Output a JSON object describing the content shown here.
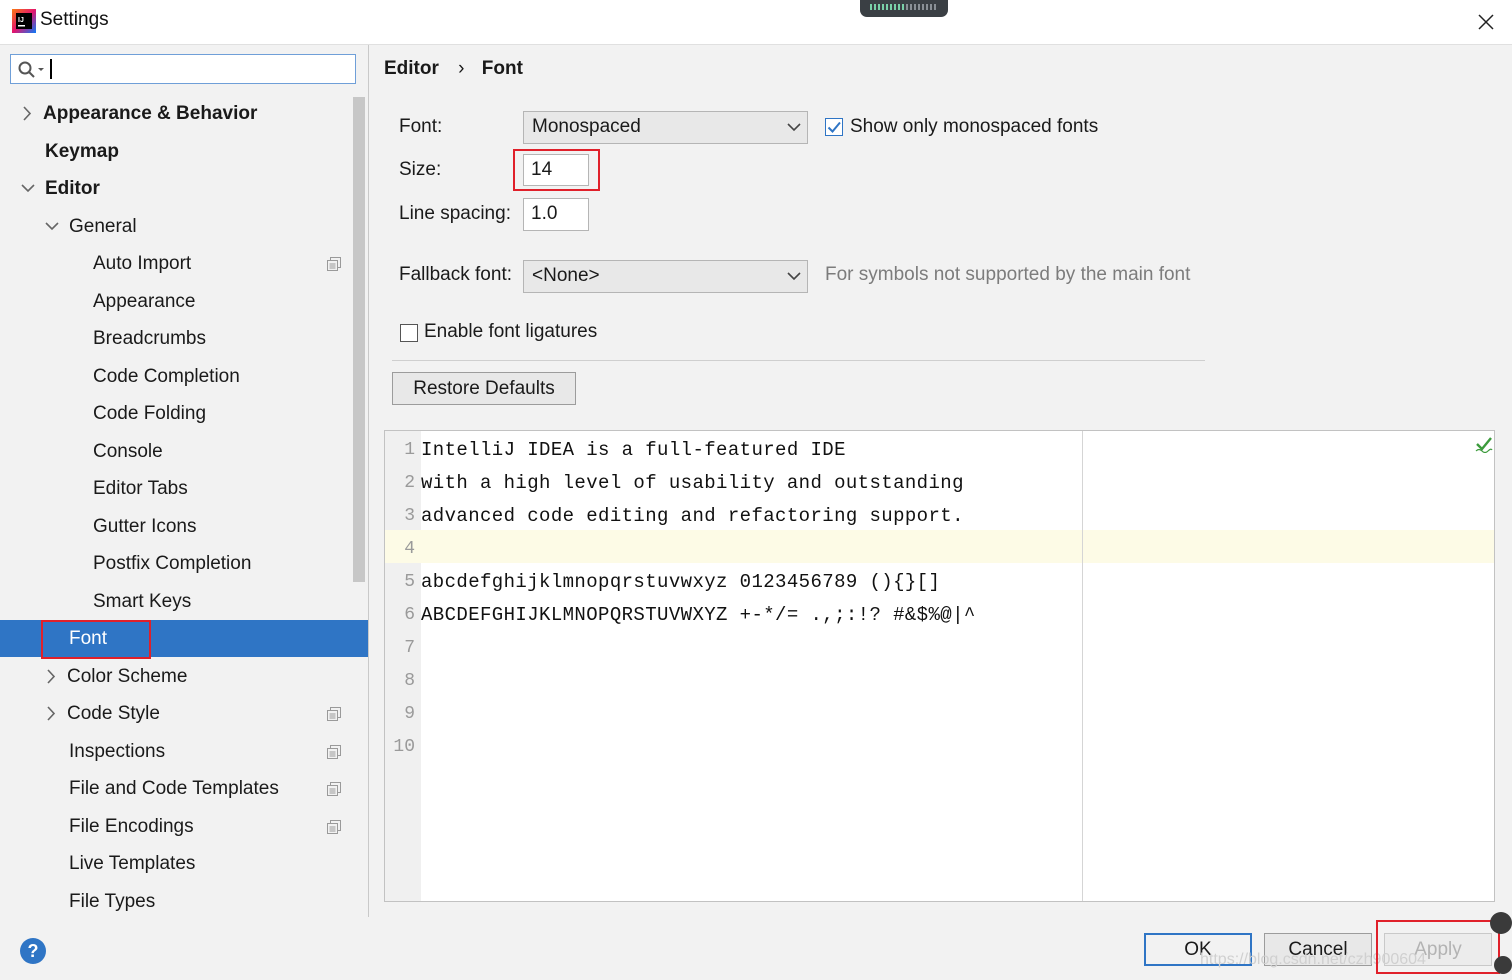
{
  "window": {
    "title": "Settings"
  },
  "search": {
    "value": ""
  },
  "sidebar": {
    "items": [
      {
        "label": "Appearance & Behavior"
      },
      {
        "label": "Keymap"
      },
      {
        "label": "Editor"
      },
      {
        "label": "General"
      },
      {
        "label": "Auto Import"
      },
      {
        "label": "Appearance"
      },
      {
        "label": "Breadcrumbs"
      },
      {
        "label": "Code Completion"
      },
      {
        "label": "Code Folding"
      },
      {
        "label": "Console"
      },
      {
        "label": "Editor Tabs"
      },
      {
        "label": "Gutter Icons"
      },
      {
        "label": "Postfix Completion"
      },
      {
        "label": "Smart Keys"
      },
      {
        "label": "Font"
      },
      {
        "label": "Color Scheme"
      },
      {
        "label": "Code Style"
      },
      {
        "label": "Inspections"
      },
      {
        "label": "File and Code Templates"
      },
      {
        "label": "File Encodings"
      },
      {
        "label": "Live Templates"
      },
      {
        "label": "File Types"
      }
    ],
    "selected": "Font"
  },
  "breadcrumb": {
    "parent": "Editor",
    "separator": "›",
    "current": "Font"
  },
  "font_settings": {
    "font_label": "Font:",
    "font_value": "Monospaced",
    "monospaced_only_label": "Show only monospaced fonts",
    "monospaced_only_checked": true,
    "size_label": "Size:",
    "size_value": "14",
    "line_spacing_label": "Line spacing:",
    "line_spacing_value": "1.0",
    "fallback_label": "Fallback font:",
    "fallback_value": "<None>",
    "fallback_hint": "For symbols not supported by the main font",
    "ligatures_label": "Enable font ligatures",
    "ligatures_checked": false,
    "restore_label": "Restore Defaults"
  },
  "preview": {
    "lines": [
      {
        "num": "1",
        "text": "IntelliJ IDEA is a full-featured IDE"
      },
      {
        "num": "2",
        "text": "with a high level of usability and outstanding"
      },
      {
        "num": "3",
        "text": "advanced code editing and refactoring support."
      },
      {
        "num": "4",
        "text": ""
      },
      {
        "num": "5",
        "text": "abcdefghijklmnopqrstuvwxyz 0123456789 (){}[]"
      },
      {
        "num": "6",
        "text": "ABCDEFGHIJKLMNOPQRSTUVWXYZ +-*/= .,;:!? #&$%@|^"
      },
      {
        "num": "7",
        "text": ""
      },
      {
        "num": "8",
        "text": ""
      },
      {
        "num": "9",
        "text": ""
      },
      {
        "num": "10",
        "text": ""
      }
    ]
  },
  "footer": {
    "help_label": "?",
    "ok_label": "OK",
    "cancel_label": "Cancel",
    "apply_label": "Apply",
    "watermark": "https://blog.csdn.net/czh900604"
  },
  "colors": {
    "accent": "#2f75c5",
    "highlight_box": "#e0202a",
    "caret_row": "#fdfbe6"
  }
}
